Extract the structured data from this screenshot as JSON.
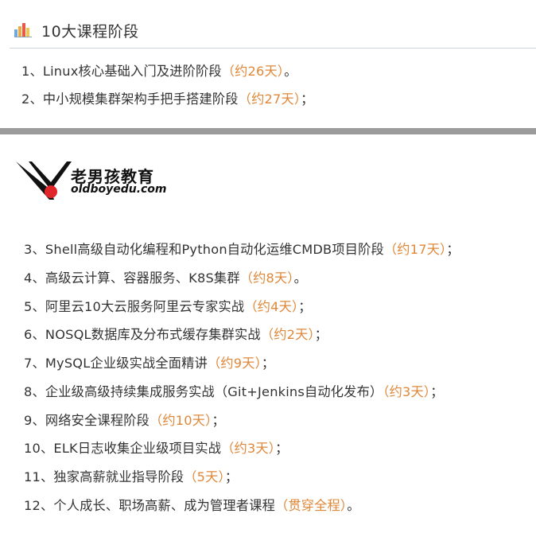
{
  "header": {
    "icon": "bar-chart-icon",
    "title": "10大课程阶段"
  },
  "intro_items": [
    {
      "text": "1、Linux核心基础入门及进阶阶段",
      "accent": "（约26天）",
      "end": "。"
    },
    {
      "text": "2、中小规模集群架构手把手搭建阶段",
      "accent": "（约27天）",
      "end": "；"
    }
  ],
  "logo": {
    "cn": "老男孩教育",
    "en": "oldboyedu.com"
  },
  "items": [
    {
      "text": "3、Shell高级自动化编程和Python自动化运维CMDB项目阶段",
      "accent": "（约17天）",
      "end": "；"
    },
    {
      "text": "4、高级云计算、容器服务、K8S集群",
      "accent": "（约8天）",
      "end": "。"
    },
    {
      "text": "5、阿里云10大云服务阿里云专家实战",
      "accent": "（约4天）",
      "end": "；"
    },
    {
      "text": "6、NOSQL数据库及分布式缓存集群实战",
      "accent": "（约2天）",
      "end": "；"
    },
    {
      "text": "7、MySQL企业级实战全面精讲",
      "accent": "（约9天）",
      "end": "；"
    },
    {
      "text": "8、企业级高级持续集成服务实战（Git+Jenkins自动化发布）",
      "accent": "（约3天）",
      "end": "；"
    },
    {
      "text": "9、网络安全课程阶段",
      "accent": "（约10天）",
      "end": "；"
    },
    {
      "text": "10、ELK日志收集企业级项目实战",
      "accent": "（约3天）",
      "end": "；"
    },
    {
      "text": "11、独家高薪就业指导阶段",
      "accent": "（5天）",
      "end": "；"
    },
    {
      "text": "12、个人成长、职场高薪、成为管理者课程",
      "accent": "（贯穿全程）",
      "end": "。"
    }
  ],
  "colors": {
    "accent": "#e0883a",
    "text": "#333333",
    "rule": "#c9d6df",
    "divider": "#9b9b9b",
    "logo_red": "#e0262b"
  }
}
